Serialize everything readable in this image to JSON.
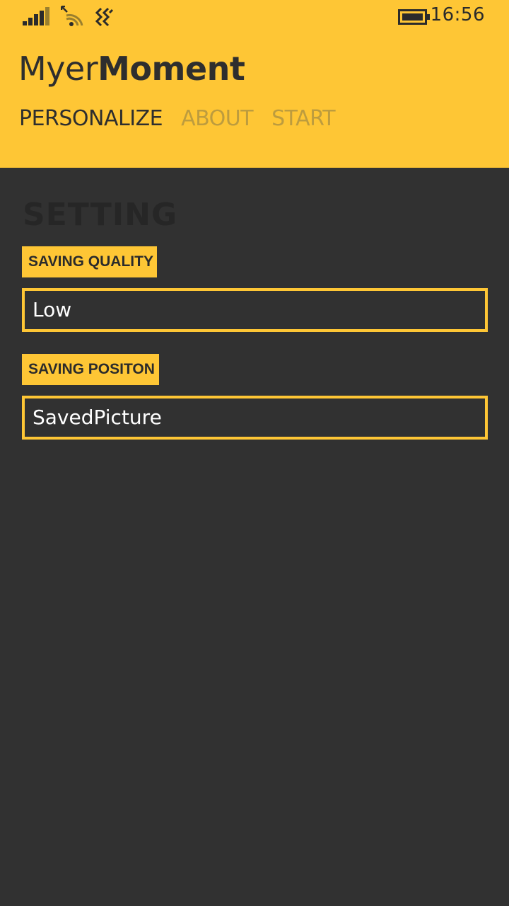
{
  "status_bar": {
    "time": "16:56",
    "icons": [
      "signal-icon",
      "wifi-icon",
      "vibrate-icon",
      "battery-icon"
    ]
  },
  "app": {
    "title_light": "Myer",
    "title_bold": "Moment"
  },
  "tabs": [
    {
      "label": "PERSONALIZE",
      "active": true
    },
    {
      "label": "ABOUT",
      "active": false
    },
    {
      "label": "START",
      "active": false
    }
  ],
  "settings": {
    "title": "SETTING",
    "quality": {
      "label": "SAVING QUALITY",
      "value": "Low"
    },
    "position": {
      "label": "SAVING POSITON",
      "value": "SavedPicture"
    }
  },
  "colors": {
    "accent": "#FEC635",
    "background": "#313131",
    "text_dark": "#2e2e2e",
    "tab_inactive": "#BD9C3E"
  }
}
